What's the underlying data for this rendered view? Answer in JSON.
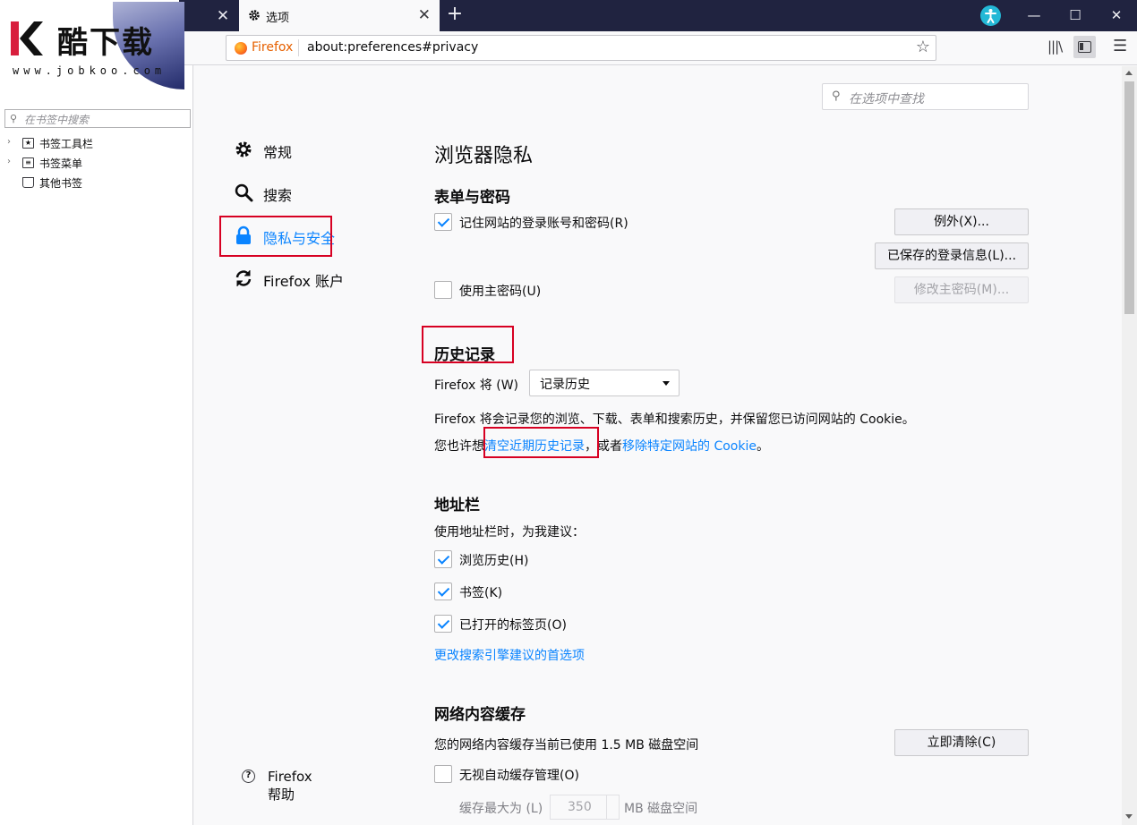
{
  "window": {
    "tab_title": "选项",
    "minimize": "—",
    "maximize": "☐",
    "close": "✕"
  },
  "urlbar": {
    "identity": "Firefox",
    "url": "about:preferences#privacy"
  },
  "watermark": {
    "brand": "酷下载",
    "site": "www.jobkoo.com"
  },
  "bookmarks_sidebar": {
    "search_placeholder": "在书签中搜索",
    "items": [
      {
        "label": "书签工具栏",
        "icon": "bookmark-toolbar-icon"
      },
      {
        "label": "书签菜单",
        "icon": "bookmark-menu-icon"
      },
      {
        "label": "其他书签",
        "icon": "other-bookmarks-icon"
      }
    ]
  },
  "prefs": {
    "search_placeholder": "在选项中查找",
    "categories": [
      {
        "label": "常规",
        "icon": "gear-icon"
      },
      {
        "label": "搜索",
        "icon": "search-icon"
      },
      {
        "label": "隐私与安全",
        "icon": "lock-icon",
        "selected": true
      },
      {
        "label": "Firefox 账户",
        "icon": "sync-icon"
      }
    ],
    "help": "Firefox 帮助",
    "page_title": "浏览器隐私",
    "forms": {
      "heading": "表单与密码",
      "remember_logins": "记住网站的登录账号和密码(R)",
      "remember_logins_checked": true,
      "exceptions_button": "例外(X)...",
      "saved_logins_button": "已保存的登录信息(L)...",
      "master_password": "使用主密码(U)",
      "master_password_checked": false,
      "change_master_button": "修改主密码(M)..."
    },
    "history": {
      "heading": "历史记录",
      "will_label": "Firefox 将 (W)",
      "mode_value": "记录历史",
      "description": "Firefox 将会记录您的浏览、下载、表单和搜索历史，并保留您已访问网站的 Cookie。",
      "also_prefix": "您也许想",
      "clear_link": "清空近期历史记录",
      "or_text": "，或者",
      "remove_cookie_link": "移除特定网站的 Cookie",
      "end_text": "。"
    },
    "addressbar": {
      "heading": "地址栏",
      "intro": "使用地址栏时，为我建议：",
      "options": [
        {
          "label": "浏览历史(H)",
          "checked": true
        },
        {
          "label": "书签(K)",
          "checked": true
        },
        {
          "label": "已打开的标签页(O)",
          "checked": true
        }
      ],
      "change_link": "更改搜索引擎建议的首选项"
    },
    "cache": {
      "heading": "网络内容缓存",
      "usage": "您的网络内容缓存当前已使用 1.5 MB 磁盘空间",
      "clear_button": "立即清除(C)",
      "override": "无视自动缓存管理(O)",
      "override_checked": false,
      "limit_prefix": "缓存最大为 (L)",
      "limit_value": "350",
      "limit_suffix": "MB 磁盘空间"
    }
  },
  "colors": {
    "accent": "#0a84ff",
    "highlight": "#d70022",
    "tabbar": "#202340"
  }
}
